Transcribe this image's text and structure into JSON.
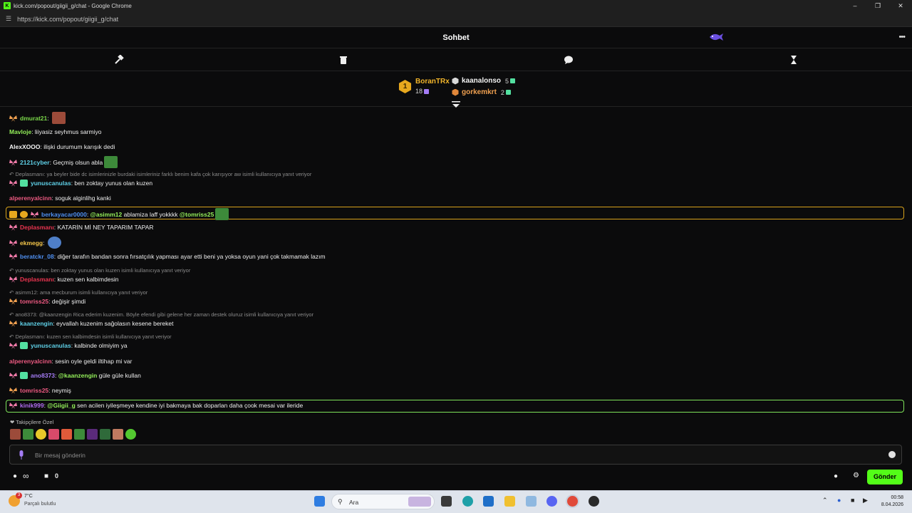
{
  "window": {
    "title": "kick.com/popout/giigii_g/chat - Google Chrome",
    "url": "https://kick.com/popout/giigii_g/chat",
    "favicon": "K"
  },
  "header": {
    "title": "Sohbet"
  },
  "toolbar": {
    "icons": [
      "hammer-icon",
      "trash-icon",
      "chat-bubble-icon",
      "hourglass-icon"
    ]
  },
  "leaderboard": {
    "first": {
      "rank": "1",
      "name": "BoranTRx",
      "value": "18"
    },
    "second": {
      "name": "kaanalonso",
      "value": "5"
    },
    "third": {
      "name": "gorkemkrt",
      "value": "2"
    }
  },
  "messages": [
    {
      "user": "dmurat21",
      "text": "",
      "color": "#7bd84a"
    },
    {
      "user": "Mavloje",
      "text": "liiyasiz seyhmus sarmiyo",
      "color": "#94f05a"
    },
    {
      "user": "AlexXOOO",
      "text": "ilişki durumum karışık dedi",
      "color": "#f4f4f4"
    },
    {
      "user": "2121cyber",
      "text": "Geçmiş olsun abla",
      "color": "#5fd1e8"
    },
    {
      "reply": "Deplasmanı: ya beyler bide dc isimlerinizle burdaki isimleriniz farklı benim kafa çok karışıyor aw isimli kullanıcıya yanıt veriyor"
    },
    {
      "user": "yunuscanulas",
      "text": "ben zoktay yunus olan kuzen",
      "color": "#5fd1e8"
    },
    {
      "user": "alperenyalcinn",
      "text": "soguk alginlihg kanki",
      "color": "#ee5a82"
    },
    {
      "user": "berkayacar0000",
      "mention1": "@asimm12",
      "text": "ablamiza laff yokkkk",
      "mention2": "@tomriss25",
      "color": "#4f8ff0"
    },
    {
      "user": "Deplasmanı",
      "text": "KATARİN Mİ NEY TAPARIM TAPAR",
      "color": "#e8344f"
    },
    {
      "user": "ekmegg",
      "text": "",
      "color": "#f5c64a"
    },
    {
      "user": "beratckr_08",
      "text": "diğer tarafın bandan sonra fırsatçılık yapması ayar etti beni ya yoksa oyun yani çok takmamak lazım",
      "color": "#4f8ff0"
    },
    {
      "reply": "yunuscanulas: ben zoktay yunus olan kuzen isimli kullanıcıya yanıt veriyor"
    },
    {
      "user": "Deplasmanı",
      "text": "kuzen sen kalbimdesin",
      "color": "#e8344f"
    },
    {
      "reply": "asimm12: ama mecburum isimli kullanıcıya yanıt veriyor"
    },
    {
      "user": "tomriss25",
      "text": "değişir şimdi",
      "color": "#ee5a82"
    },
    {
      "reply": "ano8373: @kaanzengin Rica ederim kuzenim. Böyle efendi gibi gelene her zaman destek oluruz isimli kullanıcıya yanıt veriyor"
    },
    {
      "user": "kaanzengin",
      "text": "eyvallah kuzenim sağolasın kesene bereket",
      "color": "#5fd1e8"
    },
    {
      "reply": "Deplasmanı: kuzen sen kalbimdesin isimli kullanıcıya yanıt veriyor"
    },
    {
      "user": "yunuscanulas",
      "text": "kalbinde olmiyim ya",
      "color": "#5fd1e8"
    },
    {
      "user": "alperenyalcinn",
      "text": "sesin oyle geldi iltihap mi var",
      "color": "#ee5a82"
    },
    {
      "user": "ano8373",
      "mention1": "@kaanzengin",
      "text": "güle güle kullan",
      "color": "#a47cf5"
    },
    {
      "user": "tomriss25",
      "text": "neymiş",
      "color": "#ee5a82"
    },
    {
      "user": "kinik999",
      "mention1": "@Giigii_g",
      "text": "sen acilen iyileşmeye kendine iyi bakmaya bak doparlan daha çook mesai var ileride",
      "color": "#b06cf0"
    }
  ],
  "followers_label": "Takipçilere Özel",
  "input": {
    "placeholder": "Bir mesaj gönderin"
  },
  "bottom": {
    "points": "∞",
    "count": "0",
    "send": "Gönder"
  },
  "taskbar": {
    "temp": "7°C",
    "weather": "Parçalı bulutlu",
    "search": "Ara",
    "time": "00:58",
    "date": "8.04.2026",
    "notif": "3"
  },
  "colors": {
    "accent": "#53fc18",
    "gold": "#f2b52a",
    "highlight_gold": "#d8a21b",
    "highlight_green": "#7ee35a"
  }
}
